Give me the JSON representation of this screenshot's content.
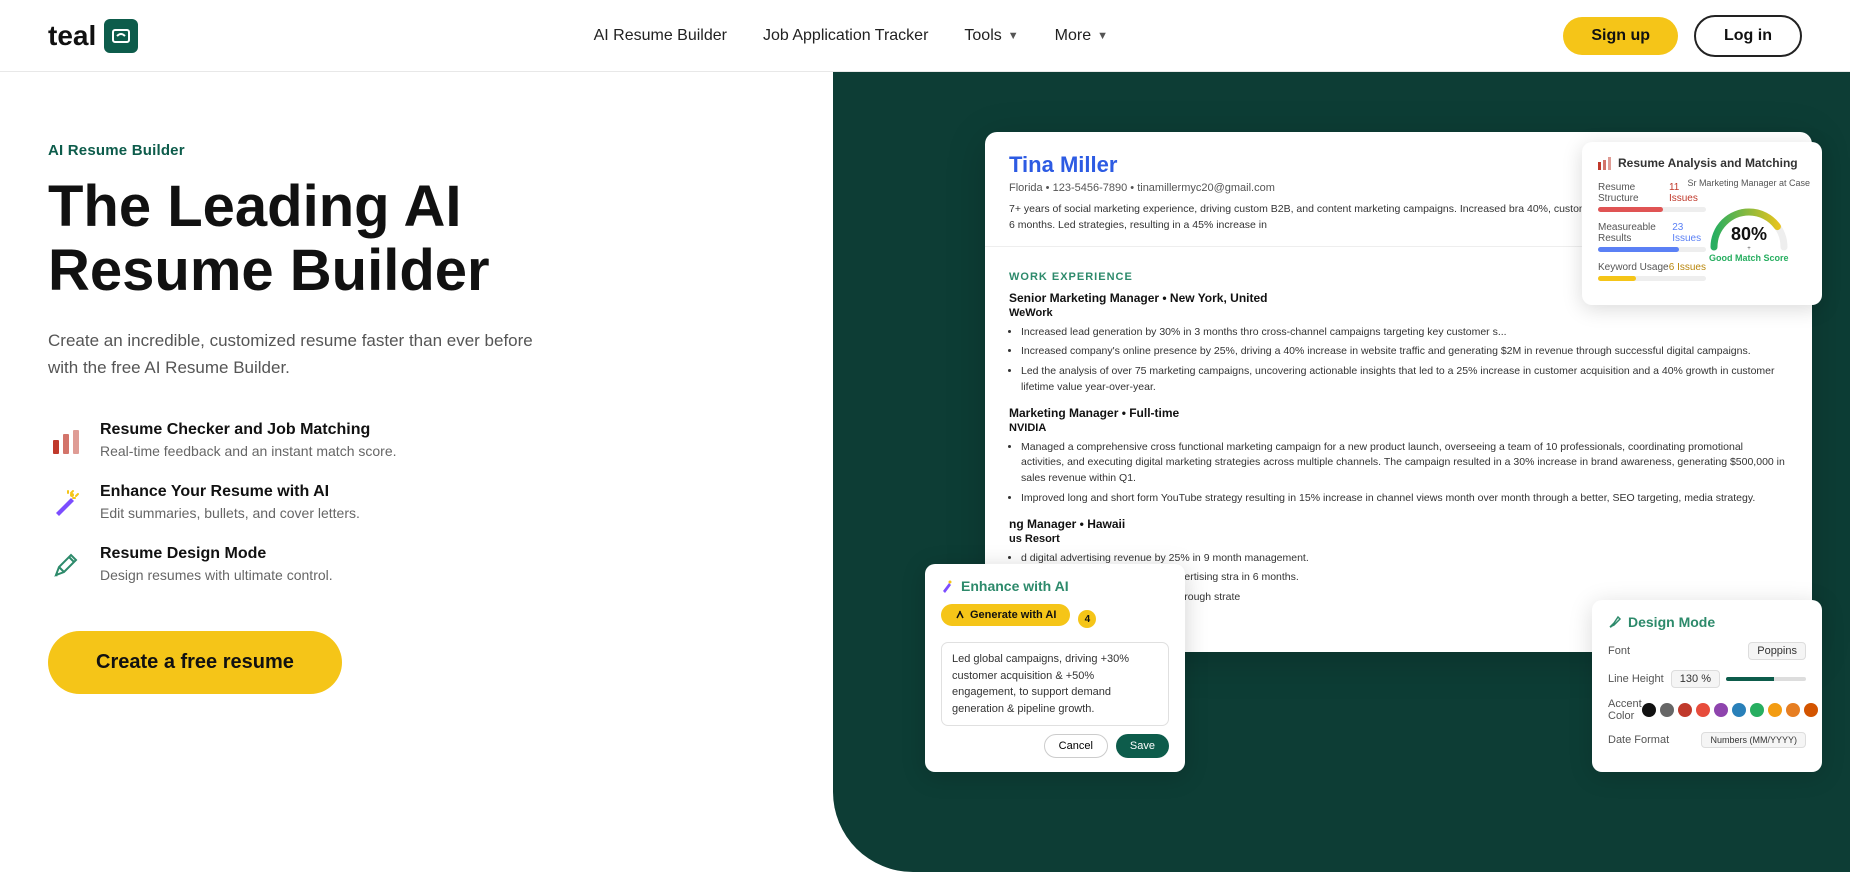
{
  "nav": {
    "logo_text": "teal",
    "links": [
      {
        "label": "AI Resume Builder",
        "has_dropdown": false
      },
      {
        "label": "Job Application Tracker",
        "has_dropdown": false
      },
      {
        "label": "Tools",
        "has_dropdown": true
      },
      {
        "label": "More",
        "has_dropdown": true
      }
    ],
    "signup_label": "Sign up",
    "login_label": "Log in"
  },
  "hero": {
    "badge": "AI Resume Builder",
    "title_line1": "The Leading AI",
    "title_line2": "Resume Builder",
    "subtitle": "Create an incredible, customized resume faster than ever before with the free AI Resume Builder.",
    "cta_label": "Create a free resume",
    "features": [
      {
        "id": "checker",
        "title": "Resume Checker and Job Matching",
        "desc": "Real-time feedback and an instant match score."
      },
      {
        "id": "enhance",
        "title": "Enhance Your Resume with AI",
        "desc": "Edit summaries, bullets, and cover letters."
      },
      {
        "id": "design",
        "title": "Resume Design Mode",
        "desc": "Design resumes with ultimate control."
      }
    ]
  },
  "resume": {
    "name": "Tina Miller",
    "location": "Florida",
    "phone": "123-5456-7890",
    "email": "tinamillermyc20@gmail.com",
    "summary": "7+ years of social marketing experience, driving custom B2B, and content marketing campaigns. Increased bra 40%, customer acquisition by 25%, customer lifetime va 6 months. Led strategies, resulting in a 45% increase in",
    "work_experience_label": "WORK EXPERIENCE",
    "jobs": [
      {
        "title": "Senior Marketing Manager • New York, United",
        "company": "WeWork",
        "bullets": [
          "Increased lead generation by 30% in 3 months thro cross-channel campaigns targeting key customer s...",
          "Increased company's online presence by 25%, driving a 40% increase in website traffic and generating $2M in revenue through successful digital campaigns.",
          "Led the analysis of over 75 marketing campaigns, uncovering actionable insights that led to a 25% increase in customer acquisition and a 40% growth in customer lifetime value year-over-year."
        ]
      },
      {
        "title": "Marketing Manager • Full-time",
        "company": "NVIDIA",
        "bullets": [
          "Managed a comprehensive cross functional marketing campaign for a new product launch, overseeing a team of 10 professionals, coordinating promotional activities, and executing digital marketing strategies across multiple channels. The campaign resulted in a 30% increase in brand awareness, generating $500,000 in sales revenue within Q1.",
          "Improved long and short form YouTube strategy resulting in 15% increase in channel views month over month through a better, SEO targeting, media strategy."
        ]
      },
      {
        "title": "ng Manager • Hawaii",
        "company": "us Resort",
        "bullets": [
          "d digital advertising revenue by 25% in 9 month management.",
          "d a successful B2B/B2G digital advertising stra in 6 months.",
          "d web traffic by 20% in 6 months through strate"
        ]
      }
    ]
  },
  "analysis": {
    "title": "Resume Analysis and Matching",
    "rows": [
      {
        "label": "Resume Structure",
        "issues": "11 Issues",
        "fill": 60,
        "color": "bar-red"
      },
      {
        "label": "Measureable Results",
        "issues": "23 Issues",
        "fill": 75,
        "color": "bar-blue"
      },
      {
        "label": "Keyword Usage",
        "issues": "6 Issues",
        "fill": 35,
        "color": "bar-yellow"
      }
    ],
    "match_score": "80%",
    "match_label": "Good Match Score",
    "match_sublabel": "Sr Marketing Manager at Case"
  },
  "enhance": {
    "title": "Enhance with AI",
    "generate_label": "Generate with AI",
    "count": "4",
    "text": "Led global campaigns, driving +30% customer acquisition & +50% engagement, to support demand generation & pipeline growth.",
    "cancel_label": "Cancel",
    "save_label": "Save"
  },
  "design": {
    "title": "Design Mode",
    "font_label": "Font",
    "font_value": "Poppins",
    "line_height_label": "Line Height",
    "line_height_value": "130 %",
    "accent_color_label": "Accent Color",
    "date_format_label": "Date Format",
    "date_format_value": "Numbers (MM/YYYY)",
    "colors": [
      "#111111",
      "#666666",
      "#c0392b",
      "#e74c3c",
      "#8e44ad",
      "#2980b9",
      "#27ae60",
      "#f39c12",
      "#e67e22",
      "#d35400"
    ]
  }
}
